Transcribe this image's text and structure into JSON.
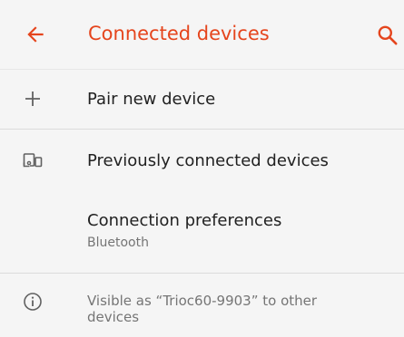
{
  "header": {
    "title": "Connected devices",
    "back_icon": "arrow-back-icon",
    "search_icon": "search-icon"
  },
  "items": [
    {
      "label": "Pair new device",
      "icon": "plus-icon"
    },
    {
      "label": "Previously connected devices",
      "icon": "devices-icon"
    },
    {
      "label": "Connection preferences",
      "sublabel": "Bluetooth"
    }
  ],
  "footer": {
    "info_text": "Visible as “Trioc60-9903” to other devices",
    "icon": "info-icon"
  },
  "colors": {
    "accent": "#e5451d",
    "background": "#f5f5f5",
    "divider": "#dcdcdc",
    "secondary_text": "#757575"
  }
}
